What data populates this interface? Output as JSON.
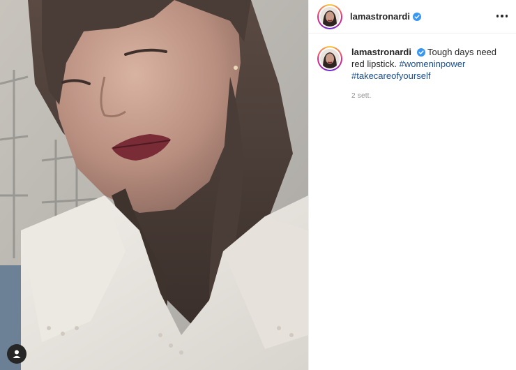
{
  "post": {
    "username": "lamastronardi",
    "verified": true,
    "caption_text": "Tough days need red lipstick.",
    "hashtags": [
      "#womeninpower",
      "#takecareofyourself"
    ],
    "timestamp": "2 sett."
  },
  "icons": {
    "more": "more-options-icon",
    "verified": "verified-badge-icon",
    "user_tag": "user-tag-icon"
  },
  "colors": {
    "verified_blue": "#3897f0",
    "hashtag_blue": "#1a4f8f",
    "text": "#262626",
    "muted": "#8e8e8e"
  }
}
